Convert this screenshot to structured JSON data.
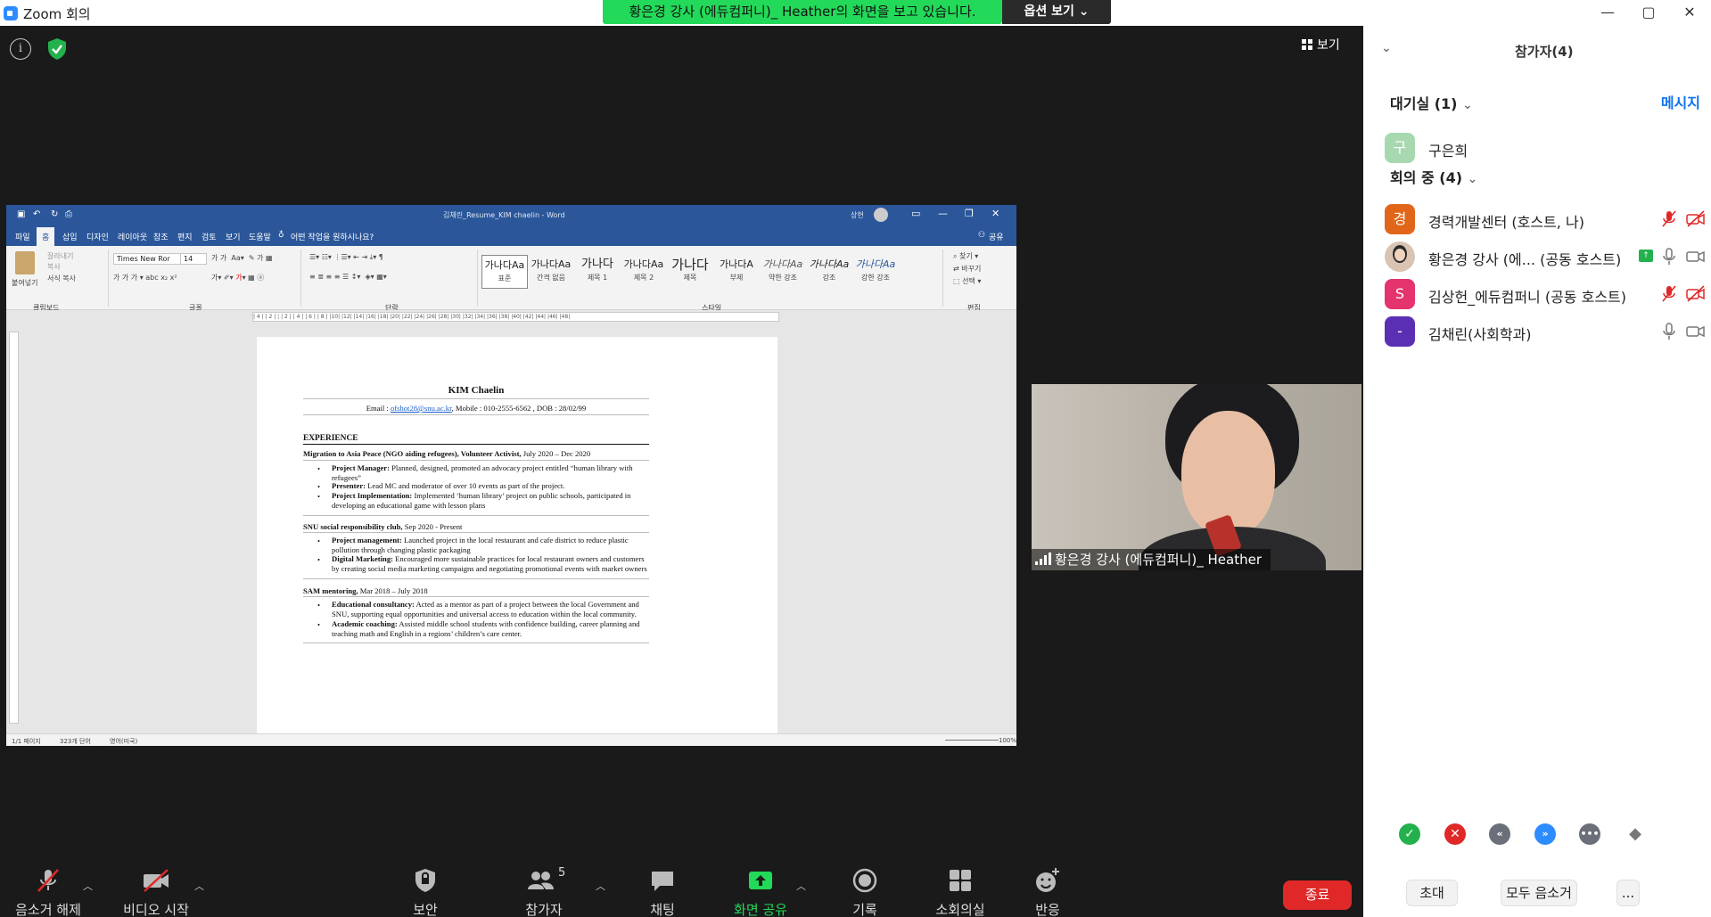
{
  "window": {
    "title": "Zoom 회의",
    "minimize": "—",
    "maximize": "▢",
    "close": "✕"
  },
  "banner": {
    "text": "황은경 강사 (에듀컴퍼니)_ Heather의 화면을 보고 있습니다.",
    "options": "옵션 보기 ⌄"
  },
  "view": {
    "label": "보기"
  },
  "word": {
    "doc_title": "김채린_Resume_KIM chaelin  -  Word",
    "user": "상현",
    "tabs": [
      "파일",
      "홈",
      "삽입",
      "디자인",
      "레이아웃",
      "참조",
      "편지",
      "검토",
      "보기",
      "도움말"
    ],
    "tell_me": "어떤 작업을 원하시나요?",
    "share": "공유",
    "ribbon": {
      "paste": "붙여넣기",
      "cut": "잘라내기",
      "copy": "복사",
      "format_painter": "서식 복사",
      "clipboard": "클립보드",
      "font_name": "Times New Ror",
      "font_size": "14",
      "font_group": "글꼴",
      "paragraph_group": "단락",
      "styles_group": "스타일",
      "editing_group": "편집",
      "find": "찾기",
      "replace": "바꾸기",
      "select": "선택",
      "styles": [
        {
          "preview": "가나다Aa",
          "name": "표준"
        },
        {
          "preview": "가나다Aa",
          "name": "간격 없음"
        },
        {
          "preview": "가나다",
          "name": "제목 1"
        },
        {
          "preview": "가나다Aa",
          "name": "제목 2"
        },
        {
          "preview": "가나다",
          "name": "제목"
        },
        {
          "preview": "가나다A",
          "name": "부제"
        },
        {
          "preview": "가나다Aa",
          "name": "약한 강조"
        },
        {
          "preview": "가나다Aa",
          "name": "강조"
        },
        {
          "preview": "가나다Aa",
          "name": "강한 강조"
        }
      ]
    },
    "ruler_text": "| 4 |   | 2 |   ¦   | 2 |   | 4 |   | 6 |   | 8 |   |10|   |12|   |14|   |16|   |18|   |20|   |22|   |24|   |26|   |28|   |30|   |32|   |34|   |36|   |38|   |40|   |42|   |44|   |46|   |48|",
    "status": {
      "page": "1/1 페이지",
      "words": "323개 단어",
      "lang": "영어(미국)",
      "zoom": "100%"
    },
    "doc": {
      "name": "KIM Chaelin",
      "contact_prefix": "Email : ",
      "email": "ofshot28@snu.ac.kr",
      "contact_rest": ", Mobile : 010-2555-6562 , DOB : 28/02/99",
      "section": "EXPERIENCE",
      "jobs": [
        {
          "title": "Migration to Asia Peace (NGO aiding refugees), Volunteer Activist,",
          "dates": " July 2020 – Dec 2020",
          "bullets": [
            {
              "b": "Project Manager:",
              "t": " Planned, designed, promoted an advocacy project entitled “human library with",
              "t2": "refugees”"
            },
            {
              "b": "Presenter:",
              "t": " Lead MC and moderator of over 10 events as part of the project.",
              "t2": ""
            },
            {
              "b": "Project Implementation:",
              "t": " Implemented ‘human library’ project on public schools, participated in",
              "t2": "developing an educational game with lesson plans"
            }
          ]
        },
        {
          "title": "SNU social responsibility club,",
          "dates": " Sep 2020 - Present",
          "bullets": [
            {
              "b": "Project management:",
              "t": " Launched project in the local restaurant and cafe district to reduce plastic",
              "t2": "pollution through changing plastic packaging"
            },
            {
              "b": "Digital Marketing:",
              "t": " Encouraged more sustainable practices for local restaurant owners and customers",
              "t2": "by creating social media marketing campaigns and negotiating promotional events with market owners"
            }
          ]
        },
        {
          "title": "SAM mentoring,",
          "dates": " Mar 2018 – July 2018",
          "bullets": [
            {
              "b": "Educational consultancy:",
              "t": " Acted as a mentor as part of a project between the local Government and",
              "t2": "SNU, supporting equal opportunities and universal access to education within the local community."
            },
            {
              "b": "Academic coaching:",
              "t": " Assisted middle school students with confidence building, career planning and",
              "t2": "teaching math and English in a regions’ children’s care center."
            }
          ]
        }
      ]
    }
  },
  "video": {
    "name": "황은경 강사 (에듀컴퍼니)_ Heather"
  },
  "toolbar": {
    "unmute": "음소거 해제",
    "start_video": "비디오 시작",
    "security": "보안",
    "participants": "참가자",
    "participants_count": "5",
    "chat": "채팅",
    "share_screen": "화면 공유",
    "record": "기록",
    "breakout": "소회의실",
    "reactions": "반응",
    "end": "종료"
  },
  "panel": {
    "title": "참가자(4)",
    "waiting_room": "대기실 (1)",
    "message_all": "메시지",
    "in_meeting": "회의 중 (4)",
    "waiting": [
      {
        "initial": "구",
        "name": "구은희",
        "color": "#a8d8b0"
      }
    ],
    "participants": [
      {
        "initial": "경",
        "name": "경력개발센터 (호스트, 나)",
        "color": "#e2661a",
        "muted": true,
        "video_off": true
      },
      {
        "initial": "",
        "name": "황은경 강사 (에...  (공동 호스트)",
        "color": "#d9c3b3",
        "muted": false,
        "video_off": false,
        "sharing": true
      },
      {
        "initial": "S",
        "name": "김상헌_에듀컴퍼니 (공동 호스트)",
        "color": "#e5336e",
        "muted": true,
        "video_off": true
      },
      {
        "initial": "-",
        "name": "김채린(사회학과)",
        "color": "#5b2fb3",
        "muted": false,
        "video_off": false
      }
    ],
    "invite": "초대",
    "mute_all": "모두 음소거",
    "more": "..."
  }
}
